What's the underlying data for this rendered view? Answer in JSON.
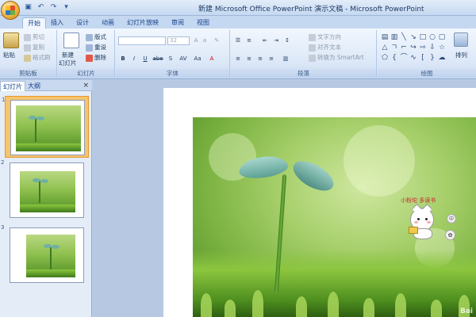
{
  "window": {
    "title": "新建 Microsoft Office PowerPoint 演示文稿 - Microsoft PowerPoint"
  },
  "tabs": [
    "开始",
    "插入",
    "设计",
    "动画",
    "幻灯片放映",
    "审阅",
    "视图"
  ],
  "ribbon": {
    "clipboard": {
      "paste": "粘贴",
      "cut": "剪切",
      "copy": "复制",
      "format_painter": "格式刷",
      "label": "剪贴板"
    },
    "slides": {
      "new_slide": "新建",
      "new_slide_line2": "幻灯片",
      "layout": "版式",
      "reset": "重设",
      "delete": "删除",
      "label": "幻灯片"
    },
    "font": {
      "size": "32",
      "label": "字体",
      "buttons": [
        "B",
        "I",
        "U",
        "abe",
        "S",
        "AV",
        "Aa",
        "A"
      ]
    },
    "paragraph": {
      "text_direction": "文字方向",
      "align_text": "对齐文本",
      "convert_smartart": "转换为 SmartArt",
      "label": "段落"
    },
    "drawing": {
      "arrange": "排列",
      "label": "绘图"
    }
  },
  "left_panel": {
    "tab_slides": "幻灯片",
    "tab_outline": "大纲",
    "close": "×",
    "slide_numbers": [
      "1",
      "2",
      "3"
    ]
  },
  "slide": {
    "sticker_caption": "小粉坨 多读书",
    "watermark": "Bai"
  },
  "icons": {
    "office_button": "office-logo-icon",
    "save": "save-icon",
    "undo": "undo-icon",
    "redo": "redo-icon"
  },
  "colors": {
    "ribbon_bg": "#dbe7f7",
    "selected_thumb": "#f7c46e",
    "workspace": "#b7c9e2"
  }
}
